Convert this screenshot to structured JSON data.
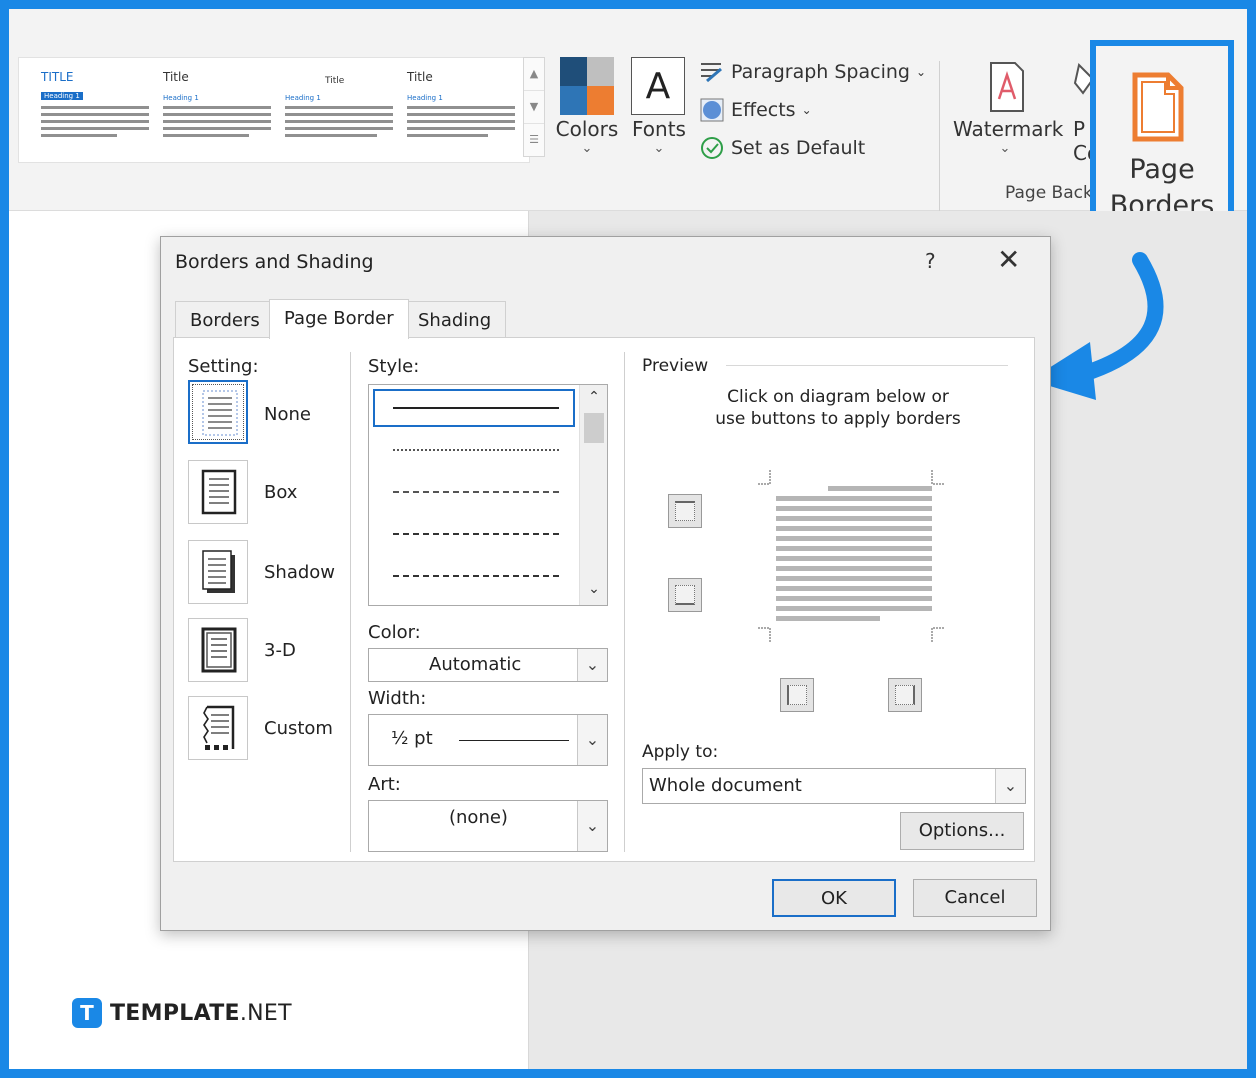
{
  "ribbon": {
    "style_thumbs": [
      {
        "title": "TITLE",
        "heading": "Heading 1"
      },
      {
        "title": "Title",
        "heading": "Heading 1"
      },
      {
        "title": "Title",
        "heading": "Heading 1"
      },
      {
        "title": "Title",
        "heading": "Heading 1"
      }
    ],
    "colors_label": "Colors",
    "fonts_label": "Fonts",
    "fonts_glyph": "A",
    "paragraph_spacing": "Paragraph Spacing",
    "effects": "Effects",
    "set_as_default": "Set as Default",
    "watermark": "Watermark",
    "page_color_partial": "P",
    "page_color_partial2": "Co",
    "group_label": "Page Back",
    "page_borders_line1": "Page",
    "page_borders_line2": "Borders",
    "accent_color": "#1a88e6"
  },
  "dialog": {
    "title": "Borders and Shading",
    "help": "?",
    "close": "✕",
    "tabs": [
      {
        "label": "Borders"
      },
      {
        "label": "Page Border"
      },
      {
        "label": "Shading"
      }
    ],
    "setting_label": "Setting:",
    "settings": [
      {
        "label": "None"
      },
      {
        "label": "Box"
      },
      {
        "label": "Shadow"
      },
      {
        "label": "3-D"
      },
      {
        "label": "Custom"
      }
    ],
    "style_label": "Style:",
    "color_label": "Color:",
    "color_value": "Automatic",
    "width_label": "Width:",
    "width_value": "½ pt",
    "art_label": "Art:",
    "art_value": "(none)",
    "preview_label": "Preview",
    "preview_hint_1": "Click on diagram below or",
    "preview_hint_2": "use buttons to apply borders",
    "apply_to_label": "Apply to:",
    "apply_to_value": "Whole document",
    "options_button": "Options...",
    "ok_button": "OK",
    "cancel_button": "Cancel"
  },
  "brand": {
    "badge": "T",
    "name_bold": "TEMPLATE",
    "name_thin": ".NET"
  }
}
